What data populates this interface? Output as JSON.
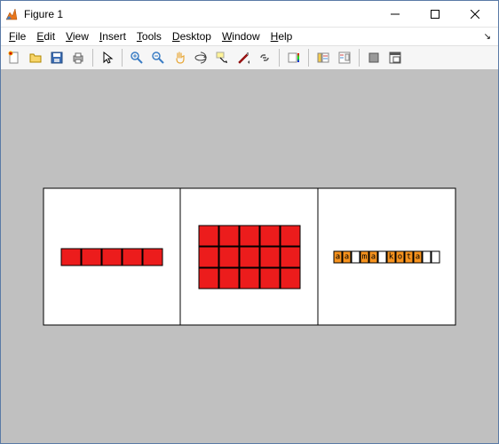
{
  "window": {
    "title": "Figure 1"
  },
  "menubar": {
    "items": [
      {
        "label": "File",
        "accel": "F"
      },
      {
        "label": "Edit",
        "accel": "E"
      },
      {
        "label": "View",
        "accel": "V"
      },
      {
        "label": "Insert",
        "accel": "I"
      },
      {
        "label": "Tools",
        "accel": "T"
      },
      {
        "label": "Desktop",
        "accel": "D"
      },
      {
        "label": "Window",
        "accel": "W"
      },
      {
        "label": "Help",
        "accel": "H"
      }
    ],
    "corner": "↘"
  },
  "toolbar": {
    "buttons": [
      {
        "name": "new-figure-icon"
      },
      {
        "name": "open-icon"
      },
      {
        "name": "save-icon"
      },
      {
        "name": "print-icon"
      },
      {
        "sep": true
      },
      {
        "name": "pointer-icon"
      },
      {
        "sep": true
      },
      {
        "name": "zoom-in-icon"
      },
      {
        "name": "zoom-out-icon"
      },
      {
        "name": "pan-icon"
      },
      {
        "name": "rotate-3d-icon"
      },
      {
        "name": "data-cursor-icon"
      },
      {
        "name": "brush-icon"
      },
      {
        "name": "link-icon"
      },
      {
        "sep": true
      },
      {
        "name": "colorbar-icon"
      },
      {
        "sep": true
      },
      {
        "name": "legend-icon"
      },
      {
        "name": "plot-tools-icon"
      },
      {
        "sep": true
      },
      {
        "name": "hide-tools-icon"
      },
      {
        "name": "dock-icon"
      }
    ]
  },
  "chart_data": [
    {
      "type": "heatmap",
      "rows": 1,
      "cols": 5,
      "values": [
        [
          1,
          1,
          1,
          1,
          1
        ]
      ],
      "colormap": {
        "1": "#ec1c1c"
      },
      "title": "",
      "xlabel": "",
      "ylabel": ""
    },
    {
      "type": "heatmap",
      "rows": 3,
      "cols": 5,
      "values": [
        [
          1,
          1,
          1,
          1,
          1
        ],
        [
          1,
          1,
          1,
          1,
          1
        ],
        [
          1,
          1,
          1,
          1,
          1
        ]
      ],
      "colormap": {
        "1": "#ec1c1c"
      },
      "title": "",
      "xlabel": "",
      "ylabel": ""
    },
    {
      "type": "heatmap",
      "rows": 1,
      "cols": 12,
      "text_labels": [
        [
          "a",
          "a",
          " ",
          "m",
          "a",
          " ",
          "k",
          "o",
          "t",
          "a",
          " ",
          " "
        ]
      ],
      "values": [
        [
          1,
          1,
          0,
          1,
          1,
          0,
          1,
          1,
          1,
          1,
          0,
          0
        ]
      ],
      "colormap": {
        "0": "#ffffff",
        "1": "#f7931e"
      },
      "string": "aa ma kota  ",
      "title": "",
      "xlabel": "",
      "ylabel": ""
    }
  ]
}
